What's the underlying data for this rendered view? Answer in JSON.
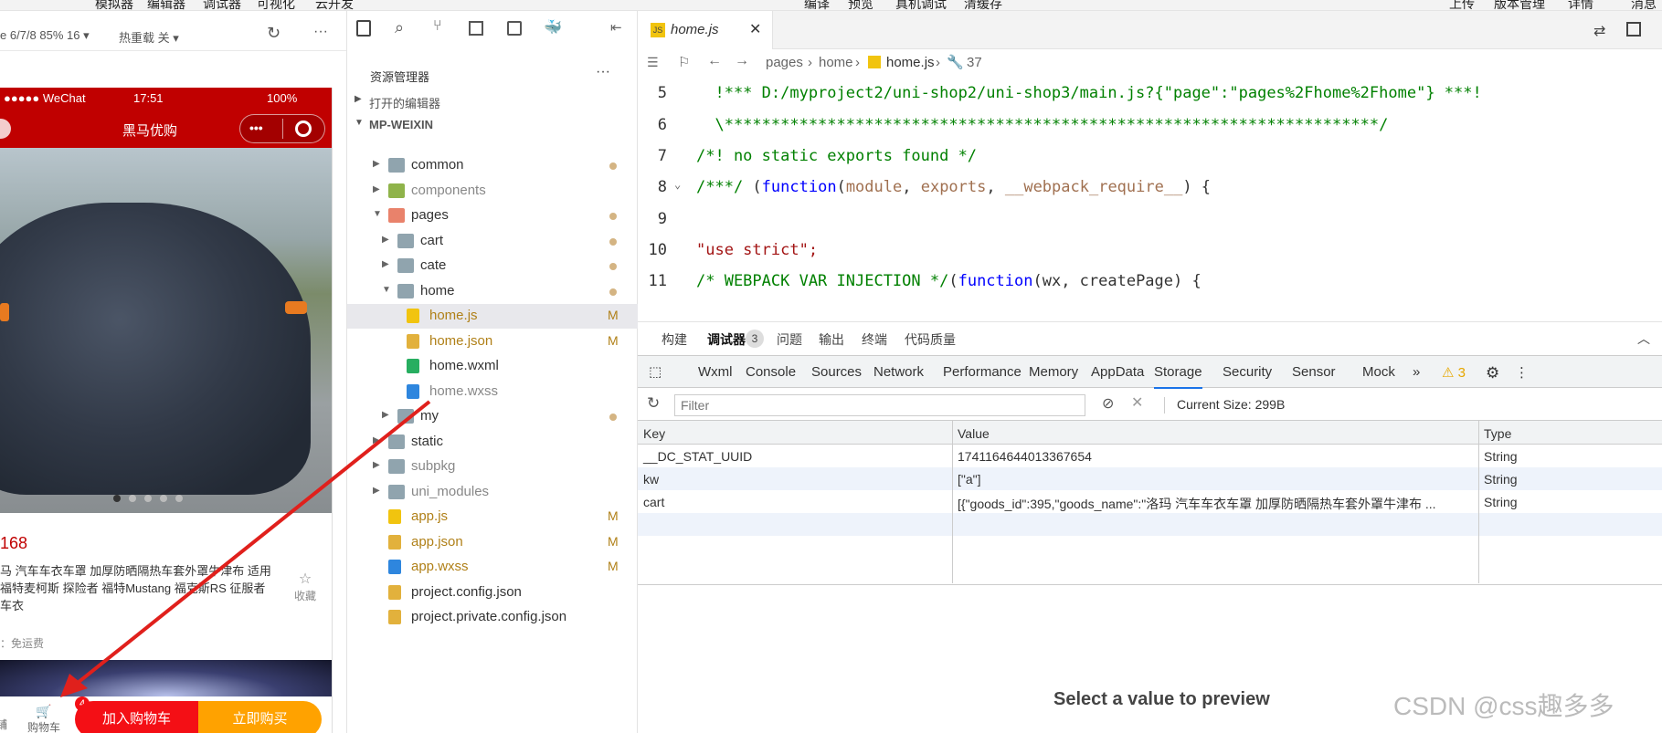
{
  "menubar": {
    "items": [
      "模拟器",
      "编辑器",
      "调试器",
      "可视化",
      "云开发",
      "编译",
      "预览",
      "真机调试",
      "清缓存",
      "上传",
      "版本管理",
      "详情",
      "消息"
    ]
  },
  "simulator": {
    "device_info": "e 6/7/8 85% 16 ▾",
    "hot_reload": "热重载 关 ▾",
    "status": {
      "carrier": "●●●●● WeChat",
      "time": "17:51",
      "battery": "100%"
    },
    "nav_title": "黑马优购",
    "price": "168",
    "goods_name": "马 汽车车衣车罩 加厚防晒隔热车套外罩牛津布 适用福特麦柯斯 探险者 福特Mustang 福克斯RS 征服者 车衣",
    "favorite": "收藏",
    "shipping": "：免运费",
    "cart_label": "购物车",
    "cart_badge": "4",
    "shop_label": "铺",
    "add_cart": "加入购物车",
    "buy_now": "立即购买"
  },
  "explorer": {
    "title": "资源管理器",
    "more": "···",
    "open_editors": "打开的编辑器",
    "project": "MP-WEIXIN",
    "items": [
      {
        "label": "common",
        "depth": 1,
        "folder": true,
        "open": false,
        "status": "dot"
      },
      {
        "label": "components",
        "depth": 1,
        "folder": true,
        "open": false,
        "status": ""
      },
      {
        "label": "pages",
        "depth": 1,
        "folder": true,
        "open": true,
        "status": "dot"
      },
      {
        "label": "cart",
        "depth": 2,
        "folder": true,
        "open": false,
        "status": "dot"
      },
      {
        "label": "cate",
        "depth": 2,
        "folder": true,
        "open": false,
        "status": "dot"
      },
      {
        "label": "home",
        "depth": 2,
        "folder": true,
        "open": true,
        "status": "dot"
      },
      {
        "label": "home.js",
        "depth": 3,
        "folder": false,
        "type": "js",
        "status": "M"
      },
      {
        "label": "home.json",
        "depth": 3,
        "folder": false,
        "type": "json",
        "status": "M"
      },
      {
        "label": "home.wxml",
        "depth": 3,
        "folder": false,
        "type": "wxml",
        "status": ""
      },
      {
        "label": "home.wxss",
        "depth": 3,
        "folder": false,
        "type": "wxss",
        "status": ""
      },
      {
        "label": "my",
        "depth": 2,
        "folder": true,
        "open": false,
        "status": "dot"
      },
      {
        "label": "static",
        "depth": 1,
        "folder": true,
        "open": false,
        "status": ""
      },
      {
        "label": "subpkg",
        "depth": 1,
        "folder": true,
        "open": false,
        "status": ""
      },
      {
        "label": "uni_modules",
        "depth": 1,
        "folder": true,
        "open": false,
        "status": ""
      },
      {
        "label": "app.js",
        "depth": 1,
        "folder": false,
        "type": "js",
        "status": "M"
      },
      {
        "label": "app.json",
        "depth": 1,
        "folder": false,
        "type": "json",
        "status": "M"
      },
      {
        "label": "app.wxss",
        "depth": 1,
        "folder": false,
        "type": "wxss",
        "status": "M"
      },
      {
        "label": "project.config.json",
        "depth": 1,
        "folder": false,
        "type": "json",
        "status": ""
      },
      {
        "label": "project.private.config.json",
        "depth": 1,
        "folder": false,
        "type": "json",
        "status": ""
      }
    ]
  },
  "editor": {
    "tab": "home.js",
    "breadcrumb": [
      "pages",
      "home",
      "home.js",
      "37"
    ],
    "lines": [
      {
        "n": "5",
        "text": "  !*** D:/myproject2/uni-shop2/uni-shop3/main.js?{\"page\":\"pages%2Fhome%2Fhome\"} ***!",
        "cls": "cm"
      },
      {
        "n": "6",
        "text": "  \\**********************************************************************/",
        "cls": "cm"
      },
      {
        "n": "7",
        "text": "/*! no static exports found */",
        "cls": "cm"
      },
      {
        "n": "8",
        "text": "/***/ (function(module, exports, __webpack_require__) {",
        "cls": "mix"
      },
      {
        "n": "9",
        "text": "",
        "cls": ""
      },
      {
        "n": "10",
        "text": "\"use strict\";",
        "cls": "str"
      },
      {
        "n": "11",
        "text": "/* WEBPACK VAR INJECTION */(function(wx, createPage) {",
        "cls": "mix2"
      }
    ]
  },
  "devtools": {
    "top_tabs": [
      "构建",
      "调试器",
      "问题",
      "输出",
      "终端",
      "代码质量"
    ],
    "debugger_badge": "3",
    "tabs": [
      "Wxml",
      "Console",
      "Sources",
      "Network",
      "Performance",
      "Memory",
      "AppData",
      "Storage",
      "Security",
      "Sensor",
      "Mock"
    ],
    "more": "»",
    "warnings": "3",
    "filter_placeholder": "Filter",
    "current_size": "Current Size: 299B",
    "columns": [
      "Key",
      "Value",
      "Type"
    ],
    "rows": [
      {
        "key": "__DC_STAT_UUID",
        "value": "1741164644013367654",
        "type": "String"
      },
      {
        "key": "kw",
        "value": "[\"a\"]",
        "type": "String"
      },
      {
        "key": "cart",
        "value": "[{\"goods_id\":395,\"goods_name\":\"洛玛 汽车车衣车罩 加厚防晒隔热车套外罩牛津布 ...",
        "type": "String"
      }
    ],
    "preview": "Select a value to preview"
  },
  "watermark": "CSDN @css趣多多",
  "colors": {
    "wechat_red": "#c00000",
    "add_cart": "#f40f15",
    "buy": "#ffa200",
    "arrow": "#e0201c"
  }
}
